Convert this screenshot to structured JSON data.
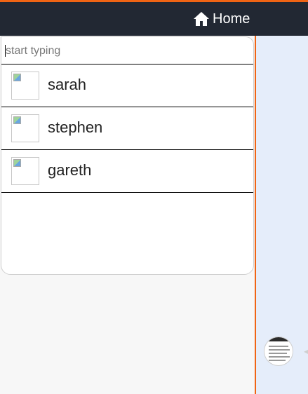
{
  "header": {
    "home_label": "Home",
    "home_icon": "home-icon"
  },
  "search": {
    "placeholder": "start typing",
    "value": ""
  },
  "results": [
    {
      "name": "sarah",
      "avatar_icon": "broken-image-icon"
    },
    {
      "name": "stephen",
      "avatar_icon": "broken-image-icon"
    },
    {
      "name": "gareth",
      "avatar_icon": "broken-image-icon"
    }
  ],
  "colors": {
    "accent": "#f06414",
    "header_bg": "#222833",
    "panel_bg": "#e5edfa"
  }
}
